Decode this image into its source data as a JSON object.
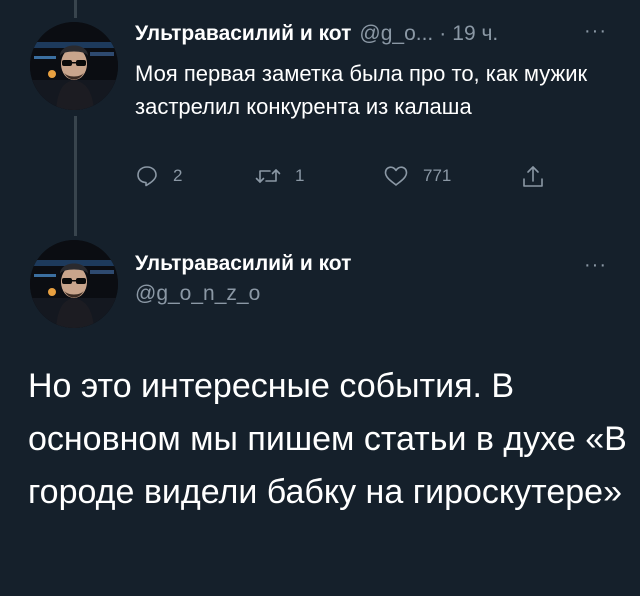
{
  "tweet1": {
    "author_name": "Ультравасилий и кот",
    "handle": "@g_o...",
    "separator": "·",
    "time": "19 ч.",
    "more_label": "···",
    "text": "Моя первая заметка была про то, как мужик застрелил конкурента из калаша",
    "actions": {
      "reply_count": "2",
      "retweet_count": "1",
      "like_count": "771",
      "share_count": ""
    }
  },
  "tweet2": {
    "author_name": "Ультравасилий и кот",
    "handle": "@g_o_n_z_o",
    "more_label": "···",
    "text": "Но это интересные события. В основном мы пишем статьи в духе «В городе видели бабку на гироскутере»"
  },
  "icons": {
    "reply": "reply-icon",
    "retweet": "retweet-icon",
    "like": "heart-icon",
    "share": "share-icon",
    "more": "more-icon"
  },
  "colors": {
    "background": "#15202b",
    "primary_text": "#ffffff",
    "secondary_text": "#8b98a5",
    "thread_line": "#38444d"
  }
}
